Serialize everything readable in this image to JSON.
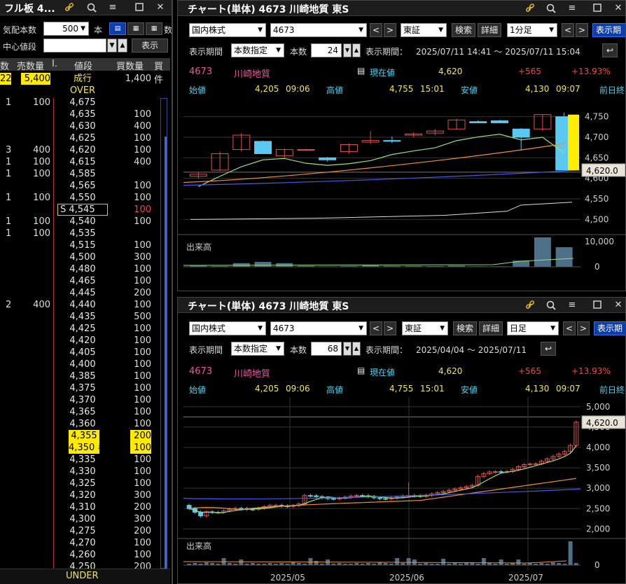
{
  "orderbook": {
    "title": "フル板 4...",
    "qty_label": "気配本数",
    "qty_value": "500",
    "qty_unit": "本",
    "center_label": "中心値段",
    "display_button": "表示",
    "head_cut": "数",
    "headers": {
      "sell_count": "数",
      "sell_qty": "売数量",
      "sell_cnt2": "I.",
      "price": "値段",
      "buy_qty": "買数量",
      "buy_cnt": "買件"
    },
    "market_row": {
      "sz": "22",
      "sell": "5,400",
      "price": "成行",
      "buy": "1,400"
    },
    "over": "OVER",
    "under": "UNDER",
    "rows": [
      {
        "sz": "1",
        "sell": "100",
        "price": "4,675",
        "buy": ""
      },
      {
        "sz": "",
        "sell": "",
        "price": "4,635",
        "buy": "100"
      },
      {
        "sz": "",
        "sell": "",
        "price": "4,630",
        "buy": "400"
      },
      {
        "sz": "",
        "sell": "",
        "price": "4,625",
        "buy": "100"
      },
      {
        "sz": "3",
        "sell": "400",
        "price": "4,620",
        "buy": "100"
      },
      {
        "sz": "1",
        "sell": "100",
        "price": "4,615",
        "buy": "400"
      },
      {
        "sz": "1",
        "sell": "100",
        "price": "4,585",
        "buy": ""
      },
      {
        "sz": "",
        "sell": "",
        "price": "4,565",
        "buy": "100"
      },
      {
        "sz": "1",
        "sell": "100",
        "price": "4,550",
        "buy": "100"
      },
      {
        "sz": "",
        "sell": "",
        "price": "S 4,545",
        "buy": "100"
      },
      {
        "sz": "1",
        "sell": "100",
        "price": "4,540",
        "buy": "100"
      },
      {
        "sz": "1",
        "sell": "100",
        "price": "4,535",
        "buy": ""
      },
      {
        "sz": "",
        "sell": "",
        "price": "4,515",
        "buy": "100"
      },
      {
        "sz": "",
        "sell": "",
        "price": "4,500",
        "buy": "300"
      },
      {
        "sz": "",
        "sell": "",
        "price": "4,480",
        "buy": "100"
      },
      {
        "sz": "",
        "sell": "",
        "price": "4,465",
        "buy": "100"
      },
      {
        "sz": "",
        "sell": "",
        "price": "4,445",
        "buy": "200"
      },
      {
        "sz": "2",
        "sell": "400",
        "price": "4,440",
        "buy": "100"
      },
      {
        "sz": "",
        "sell": "",
        "price": "4,435",
        "buy": "500"
      },
      {
        "sz": "",
        "sell": "",
        "price": "4,425",
        "buy": "100"
      },
      {
        "sz": "",
        "sell": "",
        "price": "4,420",
        "buy": "100"
      },
      {
        "sz": "",
        "sell": "",
        "price": "4,405",
        "buy": "100"
      },
      {
        "sz": "",
        "sell": "",
        "price": "4,400",
        "buy": "100"
      },
      {
        "sz": "",
        "sell": "",
        "price": "4,385",
        "buy": "100"
      },
      {
        "sz": "",
        "sell": "",
        "price": "4,375",
        "buy": "100"
      },
      {
        "sz": "",
        "sell": "",
        "price": "4,370",
        "buy": "100"
      },
      {
        "sz": "",
        "sell": "",
        "price": "4,365",
        "buy": "100"
      },
      {
        "sz": "",
        "sell": "",
        "price": "4,360",
        "buy": "100"
      },
      {
        "sz": "",
        "sell": "",
        "price": "4,355",
        "buy": "200"
      },
      {
        "sz": "",
        "sell": "",
        "price": "4,350 #",
        "buy": "100"
      },
      {
        "sz": "",
        "sell": "",
        "price": "4,335",
        "buy": "100"
      },
      {
        "sz": "",
        "sell": "",
        "price": "4,330",
        "buy": "100"
      },
      {
        "sz": "",
        "sell": "",
        "price": "4,325",
        "buy": "100"
      },
      {
        "sz": "",
        "sell": "",
        "price": "4,320",
        "buy": "300"
      },
      {
        "sz": "",
        "sell": "",
        "price": "4,310",
        "buy": "200"
      },
      {
        "sz": "",
        "sell": "",
        "price": "4,300",
        "buy": "300"
      },
      {
        "sz": "",
        "sell": "",
        "price": "4,275",
        "buy": "200"
      },
      {
        "sz": "",
        "sell": "",
        "price": "4,270",
        "buy": "100"
      },
      {
        "sz": "",
        "sell": "",
        "price": "4,260",
        "buy": "100"
      },
      {
        "sz": "",
        "sell": "",
        "price": "4,250",
        "buy": "200"
      }
    ]
  },
  "chart1": {
    "title": "チャート(単体) 4673 川崎地質 東S",
    "market_select": "国内株式",
    "code_input": "4673",
    "exchange": "東証",
    "search": "検索",
    "detail": "詳細",
    "interval": "1分足",
    "show": "表示期",
    "period_label": "表示期間",
    "period_mode": "本数指定",
    "count_label": "本数",
    "count_value": "24",
    "range_label": "表示期間：",
    "range_value": "2025/07/11 14:41 ～ 2025/07/11 15:04",
    "code": "4673",
    "name": "川崎地質",
    "current_label": "現在値",
    "current_value": "4,620",
    "change": "+565",
    "change_pct": "+13.93%",
    "open_label": "始値",
    "open_value": "4,205",
    "open_time": "09:06",
    "high_label": "高値",
    "high_value": "4,755",
    "high_time": "15:01",
    "low_label": "安値",
    "low_value": "4,130",
    "low_time": "09:07",
    "prev_label": "前日終",
    "price_tag": "4,620.0",
    "y_ticks": [
      "4,750",
      "4,700",
      "4,650",
      "4,600",
      "4,550",
      "4,500"
    ],
    "vol_label": "出来高",
    "vol_tick": "10,000"
  },
  "chart2": {
    "title": "チャート(単体) 4673 川崎地質 東S",
    "market_select": "国内株式",
    "code_input": "4673",
    "exchange": "東証",
    "search": "検索",
    "detail": "詳細",
    "interval": "日足",
    "show": "表示期",
    "period_label": "表示期間",
    "period_mode": "本数指定",
    "count_label": "本数",
    "count_value": "68",
    "range_label": "表示期間：",
    "range_value": "2025/04/04 ～ 2025/07/11",
    "code": "4673",
    "name": "川崎地質",
    "current_label": "現在値",
    "current_value": "4,620",
    "change": "+565",
    "change_pct": "+13.93%",
    "open_label": "始値",
    "open_value": "4,205",
    "open_time": "09:06",
    "high_label": "高値",
    "high_value": "4,755",
    "high_time": "15:01",
    "low_label": "安値",
    "low_value": "4,130",
    "low_time": "09:07",
    "prev_label": "前日終",
    "price_tag": "4,620.0",
    "y_ticks": [
      "5,000",
      "4,500",
      "4,000",
      "3,500",
      "3,000",
      "2,500",
      "2,000"
    ],
    "vol_label": "出来高",
    "x_ticks": [
      "2025/05",
      "2025/06",
      "2025/07"
    ]
  },
  "chart_data": [
    {
      "type": "candlestick",
      "interval": "1-minute",
      "ylim": [
        4470,
        4780
      ],
      "y_ticks": [
        4750,
        4700,
        4650,
        4600,
        4550,
        4500
      ],
      "candles": [
        {
          "o": 4605,
          "h": 4615,
          "l": 4600,
          "c": 4610
        },
        {
          "o": 4620,
          "h": 4665,
          "l": 4618,
          "c": 4660
        },
        {
          "o": 4670,
          "h": 4710,
          "l": 4665,
          "c": 4705
        },
        {
          "o": 4690,
          "h": 4692,
          "l": 4660,
          "c": 4660
        },
        {
          "o": 4655,
          "h": 4672,
          "l": 4650,
          "c": 4670
        },
        {
          "o": 4670,
          "h": 4672,
          "l": 4668,
          "c": 4670
        },
        {
          "o": 4650,
          "h": 4652,
          "l": 4640,
          "c": 4645
        },
        {
          "o": 4665,
          "h": 4685,
          "l": 4660,
          "c": 4682
        },
        {
          "o": 4688,
          "h": 4715,
          "l": 4684,
          "c": 4692
        },
        {
          "o": 4692,
          "h": 4702,
          "l": 4686,
          "c": 4690
        },
        {
          "o": 4705,
          "h": 4712,
          "l": 4700,
          "c": 4708
        },
        {
          "o": 4710,
          "h": 4720,
          "l": 4705,
          "c": 4715
        },
        {
          "o": 4720,
          "h": 4745,
          "l": 4718,
          "c": 4742
        },
        {
          "o": 4738,
          "h": 4741,
          "l": 4734,
          "c": 4735
        },
        {
          "o": 4740,
          "h": 4742,
          "l": 4735,
          "c": 4735
        },
        {
          "o": 4720,
          "h": 4722,
          "l": 4668,
          "c": 4700
        },
        {
          "o": 4720,
          "h": 4755,
          "l": 4715,
          "c": 4755
        },
        {
          "o": 4750,
          "h": 4760,
          "l": 4620,
          "c": 4620
        }
      ],
      "last_price": 4620,
      "volume_ylim": [
        0,
        12000
      ],
      "volume": [
        400,
        300,
        1500,
        2000,
        1500,
        400,
        200,
        300,
        600,
        400,
        400,
        300,
        500,
        200,
        200,
        2500,
        12000,
        8000
      ]
    },
    {
      "type": "candlestick",
      "interval": "daily",
      "x_ticks": [
        "2025/05",
        "2025/06",
        "2025/07"
      ],
      "ylim": [
        1800,
        5100
      ],
      "y_ticks": [
        5000,
        4500,
        4000,
        3500,
        3000,
        2500,
        2000
      ],
      "last_price": 4620,
      "volume_ylim": [
        0,
        3000000
      ]
    }
  ]
}
